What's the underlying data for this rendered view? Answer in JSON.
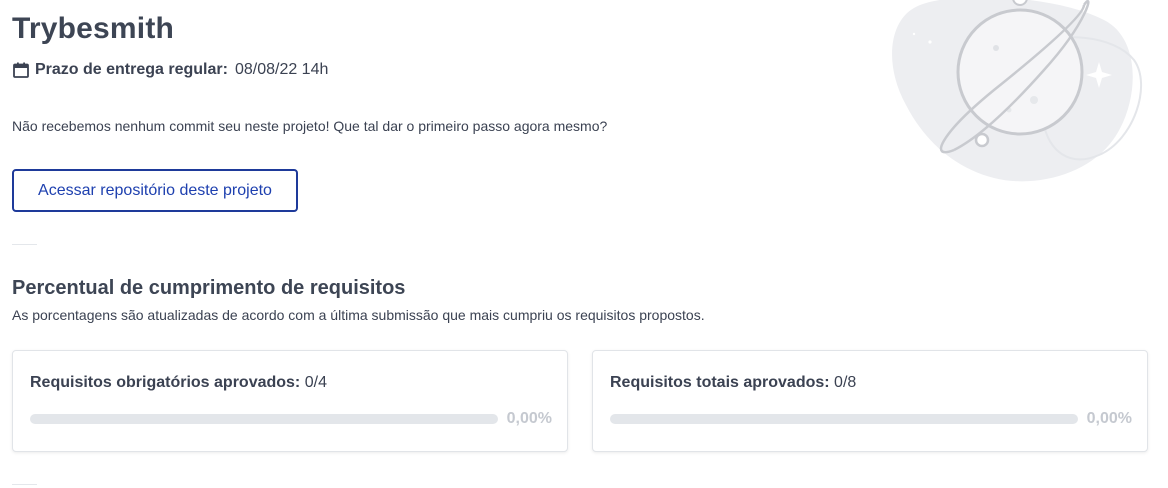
{
  "project": {
    "title": "Trybesmith",
    "deadline_label": "Prazo de entrega regular:",
    "deadline_value": "08/08/22 14h",
    "no_commit_message": "Não recebemos nenhum commit seu neste projeto! Que tal dar o primeiro passo agora mesmo?",
    "repo_button_label": "Acessar repositório deste projeto"
  },
  "requirements": {
    "title": "Percentual de cumprimento de requisitos",
    "subtitle": "As porcentagens são atualizadas de acordo com a última submissão que mais cumpriu os requisitos propostos.",
    "cards": [
      {
        "label": "Requisitos obrigatórios aprovados:",
        "value": "0/4",
        "percent_text": "0,00%",
        "progress": 0
      },
      {
        "label": "Requisitos totais aprovados:",
        "value": "0/8",
        "percent_text": "0,00%",
        "progress": 0
      }
    ]
  },
  "icons": {
    "deadline": "calendar-icon",
    "illustration": "planet-illustration"
  },
  "colors": {
    "accent": "#1e40af",
    "progress_fill": "#2fc18c",
    "progress_track": "#e3e6ea",
    "percent_text": "#c5c9d0"
  }
}
